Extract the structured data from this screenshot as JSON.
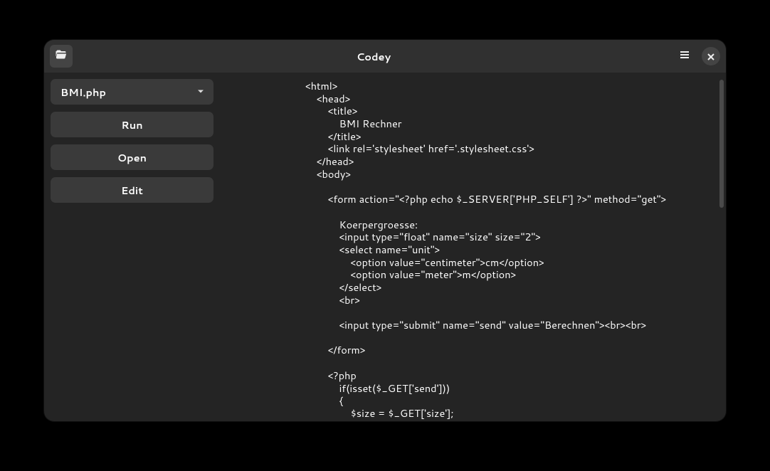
{
  "titlebar": {
    "title": "Codey"
  },
  "sidebar": {
    "file_label": "BMI.php",
    "run_label": "Run",
    "open_label": "Open",
    "edit_label": "Edit"
  },
  "editor": {
    "content": "<html>\n    <head>\n        <title>\n            BMI Rechner\n        </title>\n        <link rel='stylesheet' href='.stylesheet.css'>\n    </head>\n    <body>\n\n        <form action=\"<?php echo $_SERVER['PHP_SELF'] ?>\" method=\"get\">\n\n            Koerpergroesse:\n            <input type=\"float\" name=\"size\" size=\"2\">\n            <select name=\"unit\">\n                <option value=\"centimeter\">cm</option>\n                <option value=\"meter\">m</option>\n            </select>\n            <br>\n\n            <input type=\"submit\" name=\"send\" value=\"Berechnen\"><br><br>\n\n        </form>\n\n        <?php\n            if(isset($_GET['send']))\n            {\n                $size = $_GET['size'];"
  }
}
